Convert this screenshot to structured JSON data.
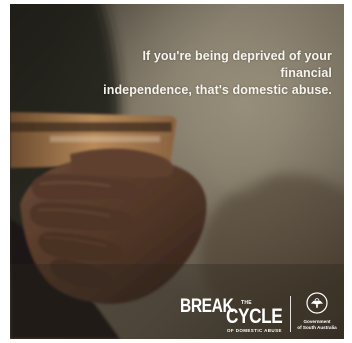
{
  "poster": {
    "headline_line1": "If you're being deprived of your financial",
    "headline_line2": "independence, that's domestic abuse.",
    "campaign": {
      "break": "BREAK",
      "the": "THE",
      "cycle": "CYCLE",
      "of_domestic_abuse": "OF DOMESTIC ABUSE"
    },
    "government": {
      "line1": "Government",
      "line2": "of South Australia"
    },
    "image_subject": "hand-holding-bank-card",
    "colors": {
      "text": "#f7f4ee",
      "card": "#b07a4c",
      "background": "#4a4236"
    }
  }
}
